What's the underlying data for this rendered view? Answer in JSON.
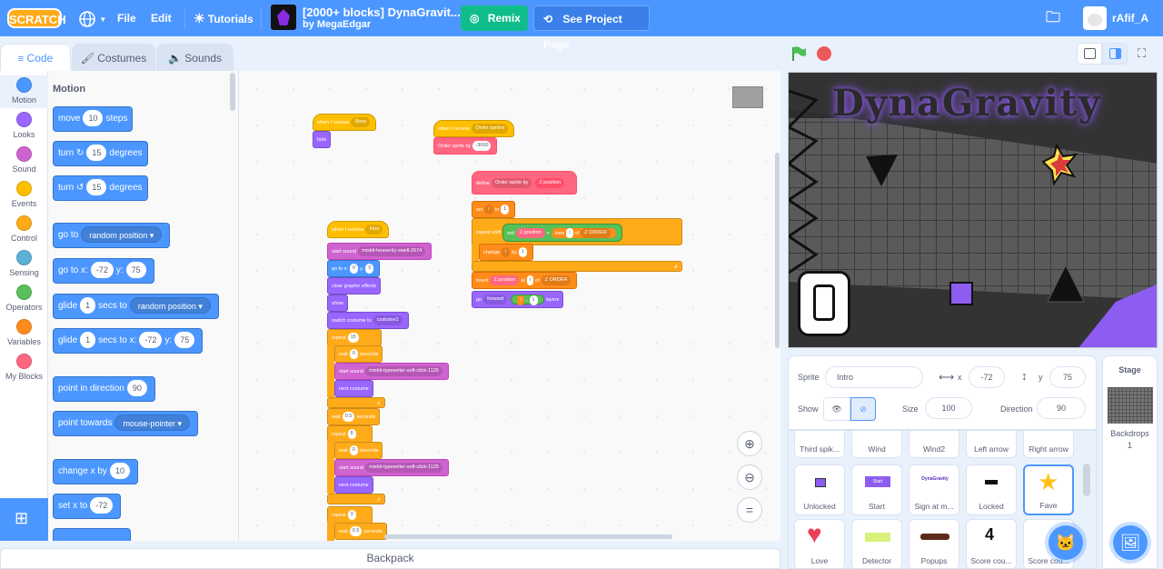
{
  "menu": {
    "logo": "SCRATCH",
    "file": "File",
    "edit": "Edit",
    "tutorials": "Tutorials",
    "project_title": "[2000+ blocks] DynaGravit...",
    "project_author": "by MegaEdgar",
    "remix": "Remix",
    "see_project": "See Project Page",
    "username": "rAfif_A"
  },
  "tabs": {
    "code": "Code",
    "costumes": "Costumes",
    "sounds": "Sounds"
  },
  "categories": [
    {
      "label": "Motion",
      "color": "#4c97ff"
    },
    {
      "label": "Looks",
      "color": "#9966ff"
    },
    {
      "label": "Sound",
      "color": "#cf63cf"
    },
    {
      "label": "Events",
      "color": "#ffbf00"
    },
    {
      "label": "Control",
      "color": "#ffab19"
    },
    {
      "label": "Sensing",
      "color": "#5cb1d6"
    },
    {
      "label": "Operators",
      "color": "#59c059"
    },
    {
      "label": "Variables",
      "color": "#ff8c1a"
    },
    {
      "label": "My Blocks",
      "color": "#ff6680"
    }
  ],
  "palette": {
    "heading": "Motion",
    "move": {
      "a": "move",
      "v": "10",
      "b": "steps"
    },
    "turn_right": {
      "a": "turn",
      "v": "15",
      "b": "degrees"
    },
    "turn_left": {
      "a": "turn",
      "v": "15",
      "b": "degrees"
    },
    "goto": {
      "a": "go to",
      "d": "random position"
    },
    "goto_xy": {
      "a": "go to x:",
      "x": "-72",
      "b": "y:",
      "y": "75"
    },
    "glide": {
      "a": "glide",
      "v": "1",
      "b": "secs to",
      "d": "random position"
    },
    "glide_xy": {
      "a": "glide",
      "v": "1",
      "b": "secs to x:",
      "x": "-72",
      "c": "y:",
      "y": "75"
    },
    "point_dir": {
      "a": "point in direction",
      "v": "90"
    },
    "point_towards": {
      "a": "point towards",
      "d": "mouse-pointer"
    },
    "change_x": {
      "a": "change x by",
      "v": "10"
    },
    "set_x": {
      "a": "set x to",
      "v": "-72"
    }
  },
  "script": {
    "s1": {
      "hat": "when I receive",
      "hat_d": "Story",
      "b1": "hide"
    },
    "s2": {
      "hat": "when I receive",
      "hat_d": "Order sprites",
      "b1": "Order sprite by",
      "b1v": "-3000"
    },
    "s3": {
      "define": "define",
      "define_a": "Order sprite by",
      "define_b": "Z position",
      "set": "set",
      "set_d": "i",
      "set_to": "to",
      "set_v": "1",
      "repeat_until": "repeat until",
      "not": "not",
      "zpos": "Z position",
      "lt": "<",
      "item": "item",
      "item_d": "i",
      "of": "of",
      "zorder": "Z ORDER",
      "change": "change",
      "change_d": "i",
      "by": "by",
      "change_v": "1",
      "insert": "insert",
      "insert_a": "Z position",
      "at": "at",
      "insert_d": "i",
      "insert_of": "of",
      "insert_list": "Z ORDER",
      "go": "go",
      "go_d": "forward",
      "go_v1": "i",
      "minus": "-",
      "go_v2": "1",
      "layers": "layers"
    },
    "s4": {
      "hat": "when I receive",
      "hat_d": "Intro",
      "start_sound": "start sound",
      "sound1": "mixkit-heavenly-swell-2674",
      "goto": "go to x:",
      "gx": "0",
      "gy_l": "y:",
      "gy": "0",
      "clear": "clear graphic effects",
      "show": "show",
      "switch": "switch costume to",
      "costume": "costume1",
      "repeat": "repeat",
      "r1": "15",
      "wait": "wait",
      "w0": "0",
      "seconds": "seconds",
      "sound2": "mixkit-typewriter-soft-click-1125",
      "next": "next costume",
      "wait05": "0.5",
      "r2": "8",
      "r3": "3"
    }
  },
  "stage_title": "DynaGravity",
  "sprite_info": {
    "sprite_label": "Sprite",
    "sprite_name": "Intro",
    "x_label": "x",
    "x": "-72",
    "y_label": "y",
    "y": "75",
    "show_label": "Show",
    "size_label": "Size",
    "size": "100",
    "direction_label": "Direction",
    "direction": "90"
  },
  "sprites": [
    {
      "name": "Third spik..."
    },
    {
      "name": "Wind"
    },
    {
      "name": "Wind2"
    },
    {
      "name": "Left arrow"
    },
    {
      "name": "Right arrow"
    },
    {
      "name": "Unlocked"
    },
    {
      "name": "Start"
    },
    {
      "name": "Sign at m..."
    },
    {
      "name": "Locked"
    },
    {
      "name": "Fave"
    },
    {
      "name": "Love"
    },
    {
      "name": "Detector"
    },
    {
      "name": "Popups"
    },
    {
      "name": "Score cou..."
    },
    {
      "name": "Score cou..."
    }
  ],
  "sprite_thumbs": {
    "start": "Start",
    "sign": "DynaGravity",
    "score": "4"
  },
  "stage_panel": {
    "title": "Stage",
    "backdrops_label": "Backdrops",
    "backdrops_count": "1"
  },
  "backpack": "Backpack",
  "colors": {
    "primary": "#4c97ff",
    "remix": "#0fbd8c",
    "flag": "#4cbf56",
    "stop": "#ec5959"
  }
}
